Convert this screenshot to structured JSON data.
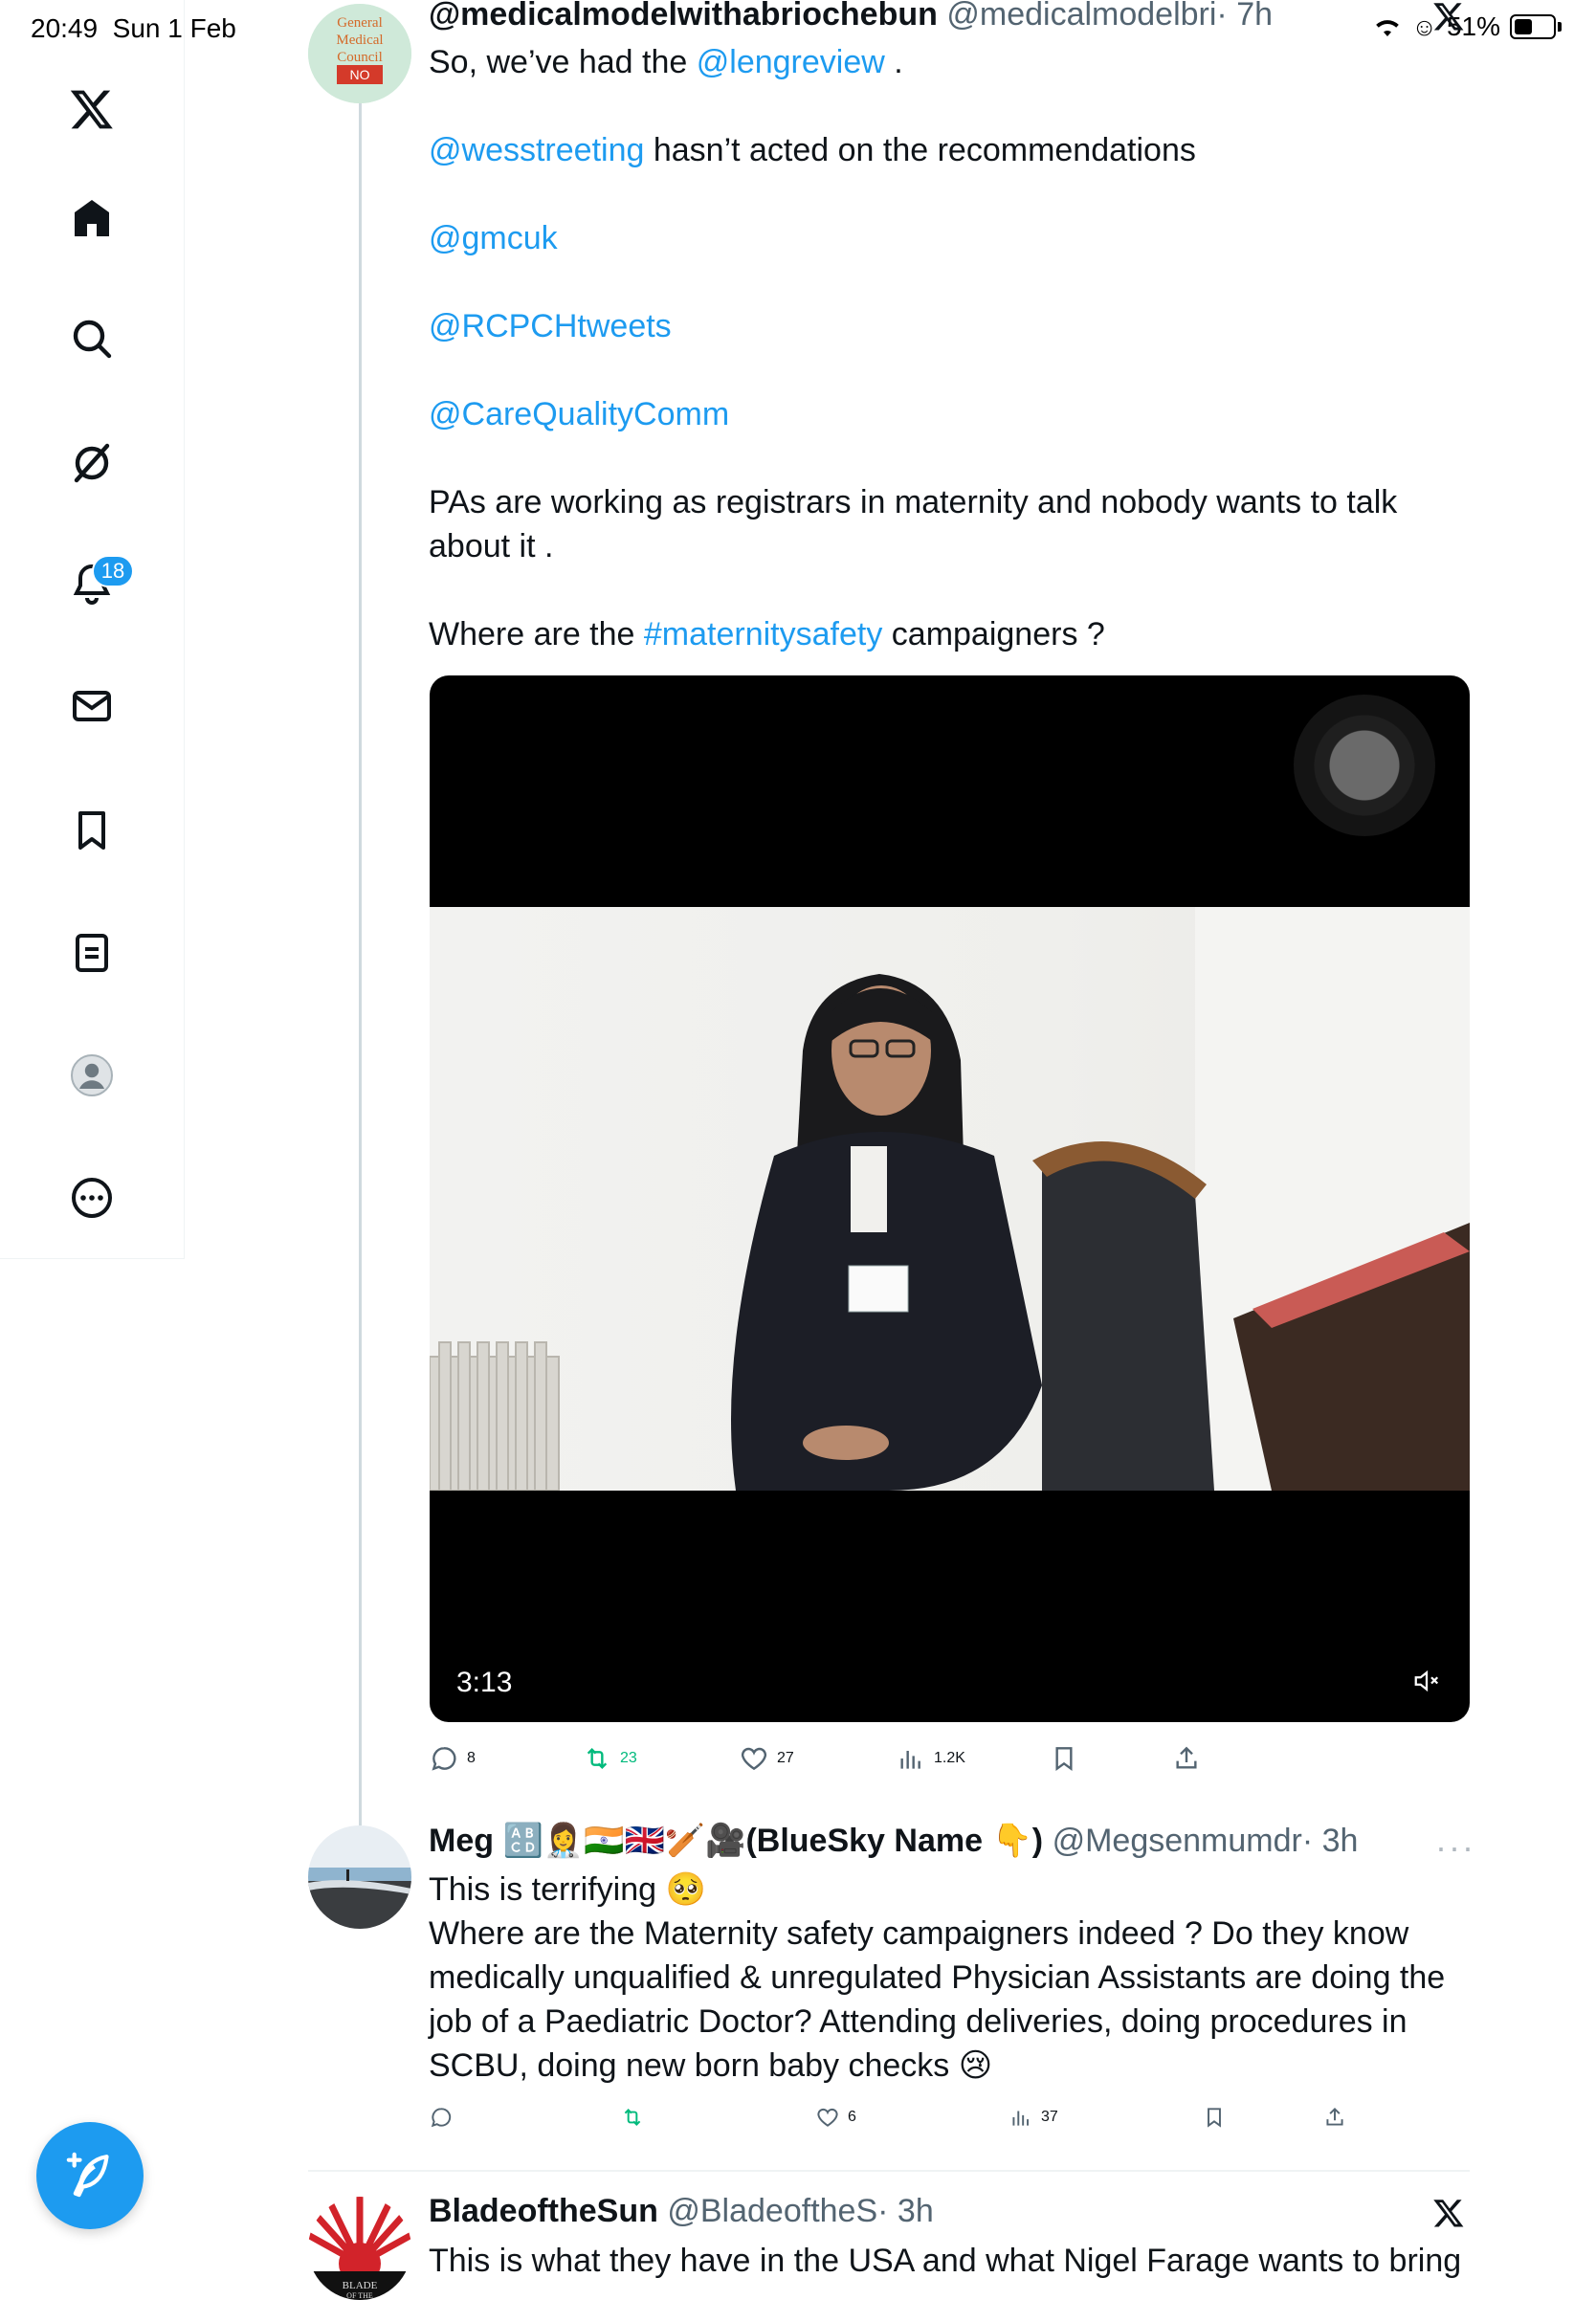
{
  "status_bar": {
    "time": "20:49",
    "date": "Sun 1 Feb",
    "battery": "51%",
    "battery_level": 0.51
  },
  "sidebar": {
    "notifications_badge": "18",
    "items": [
      "x-logo-icon",
      "home-icon",
      "search-icon",
      "grok-icon",
      "notifications-icon",
      "messages-icon",
      "bookmarks-icon",
      "lists-icon",
      "profile-icon",
      "more-icon"
    ]
  },
  "tweet1": {
    "name": "@medicalmodelwithabriochebun",
    "handle": "@medicalmodelbri",
    "time": "· 7h",
    "avatar_text": "General Medical Council NO",
    "line1_prefix": "So, we’ve had the ",
    "line1_link": "@lengreview",
    "line1_suffix": " .",
    "line2_link": "@wesstreeting",
    "line2_suffix": " hasn’t acted on the recommendations",
    "mention3": "@gmcuk",
    "mention4": "@RCPCHtweets",
    "mention5": "@CareQualityComm",
    "para6": "PAs are working as registrars in maternity and nobody wants to talk about it .",
    "line7_prefix": "Where are the ",
    "line7_link": "#maternitysafety",
    "line7_suffix": " campaigners ?",
    "video_duration": "3:13",
    "replies": "8",
    "retweets": "23",
    "likes": "27",
    "views": "1.2K"
  },
  "tweet2": {
    "name_prefix": "Meg",
    "name_emojis": "🔠👩‍⚕️🇮🇳🇬🇧🏏🎥",
    "name_suffix": "(BlueSky Name 👇)",
    "handle": "@Megsenmumdr",
    "time": "· 3h",
    "more": "···",
    "line1": "This is terrifying 🥺",
    "body": "Where are the Maternity safety campaigners indeed ? Do they know medically unqualified & unregulated Physician Assistants are doing the job of a Paediatric Doctor? Attending deliveries, doing procedures in SCBU, doing new born baby checks 😢",
    "likes": "6",
    "views": "37"
  },
  "tweet3": {
    "name": "BladeoftheSun",
    "handle": "@BladeoftheS",
    "time": "· 3h",
    "avatar_text": "BLADE OF THE",
    "text": "This is what they have in the USA and what Nigel Farage wants to bring"
  },
  "colors": {
    "accent": "#1d9bf0",
    "retweet_green": "#00ba7c",
    "text": "#0f1419",
    "muted": "#536471"
  }
}
